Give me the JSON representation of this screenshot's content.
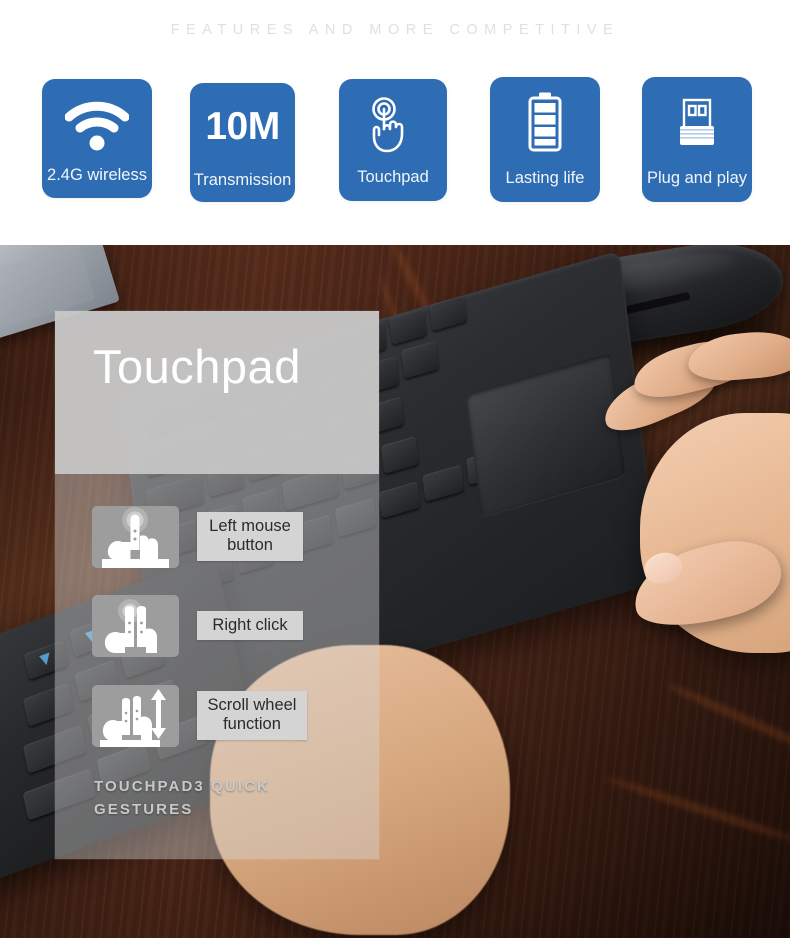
{
  "headline": "FEATURES AND MORE COMPETITIVE",
  "theme": {
    "card_blue": "#2E6DB4",
    "headline_gray": "#E0E0E2",
    "panel_gray": "#C7C7C7",
    "label_gray": "#D4D4D4",
    "icon_tile_gray": "#9D9D9D"
  },
  "features": [
    {
      "icon": "wifi-icon",
      "label": "2.4G wireless",
      "value": ""
    },
    {
      "icon": "text-icon",
      "label": "Transmission",
      "value": "10M"
    },
    {
      "icon": "touch-hand-icon",
      "label": "Touchpad",
      "value": ""
    },
    {
      "icon": "battery-icon",
      "label": "Lasting life",
      "value": ""
    },
    {
      "icon": "usb-dongle-icon",
      "label": "Plug and play",
      "value": ""
    }
  ],
  "overlay": {
    "title": "Touchpad",
    "caption": "TOUCHPAD3 QUICK GESTURES",
    "gestures": [
      {
        "icon": "one-finger-tap-icon",
        "label": "Left mouse button"
      },
      {
        "icon": "two-finger-tap-icon",
        "label": "Right click"
      },
      {
        "icon": "two-finger-scroll-icon",
        "label": "Scroll wheel function"
      }
    ]
  },
  "photo": {
    "subjects": [
      "wood-desk",
      "wireless-keyboard",
      "numeric-keypad",
      "touchpad",
      "black-mouse",
      "hand",
      "laptop-edge"
    ]
  }
}
